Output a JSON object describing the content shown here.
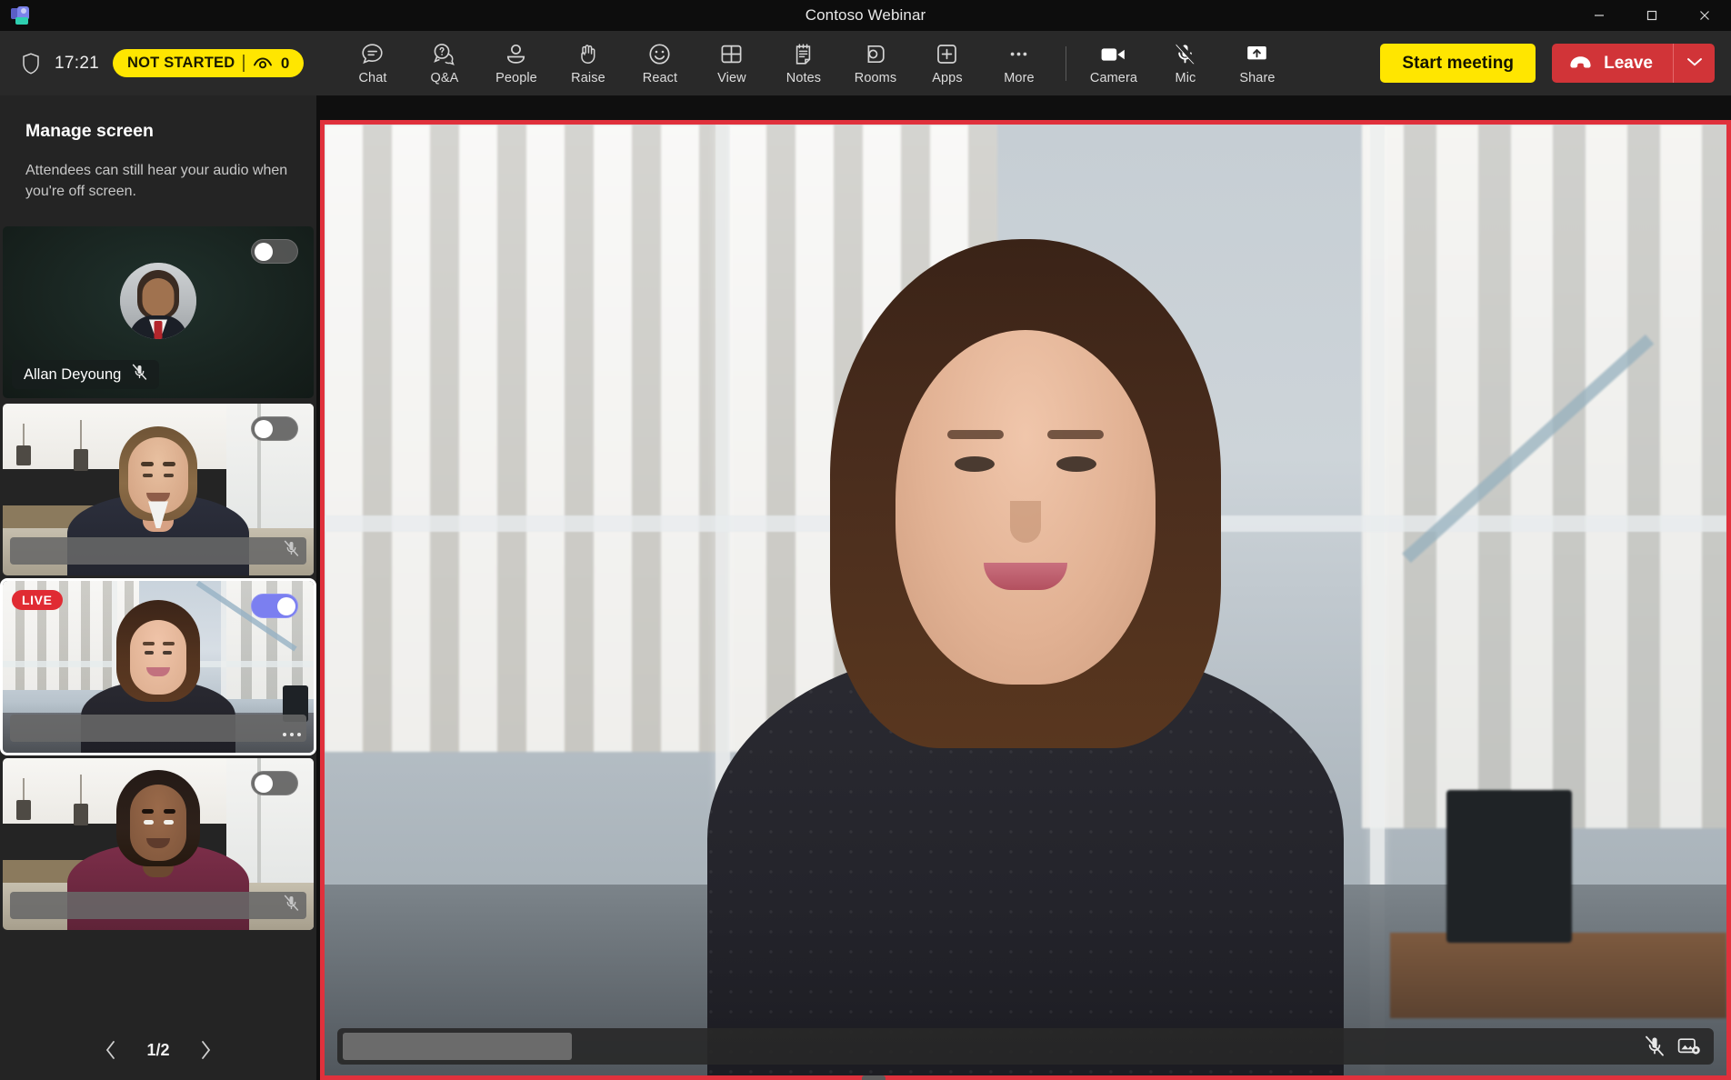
{
  "window": {
    "title": "Contoso Webinar",
    "app_icon": "teams-app-icon",
    "controls": {
      "minimize": "minimize-icon",
      "maximize": "maximize-icon",
      "close": "close-icon"
    }
  },
  "toolbar": {
    "shield_icon": "shield-icon",
    "time": "17:21",
    "status": {
      "label": "NOT STARTED",
      "viewers_icon": "eye-icon",
      "viewer_count": "0",
      "bg_color": "#ffe600"
    },
    "items": [
      {
        "label": "Chat",
        "icon": "chat-icon"
      },
      {
        "label": "Q&A",
        "icon": "question-bubble-icon"
      },
      {
        "label": "People",
        "icon": "person-icon"
      },
      {
        "label": "Raise",
        "icon": "raise-hand-icon"
      },
      {
        "label": "React",
        "icon": "smiley-icon"
      },
      {
        "label": "View",
        "icon": "grid-view-icon"
      },
      {
        "label": "Notes",
        "icon": "notes-icon"
      },
      {
        "label": "Rooms",
        "icon": "breakout-rooms-icon"
      },
      {
        "label": "Apps",
        "icon": "plus-box-icon"
      },
      {
        "label": "More",
        "icon": "ellipsis-icon"
      }
    ],
    "media": [
      {
        "label": "Camera",
        "icon": "camera-on-icon",
        "state": "on"
      },
      {
        "label": "Mic",
        "icon": "mic-muted-icon",
        "state": "muted"
      },
      {
        "label": "Share",
        "icon": "share-screen-icon",
        "state": "off"
      }
    ],
    "start_meeting_label": "Start meeting",
    "leave_label": "Leave",
    "leave_icon": "hangup-icon",
    "leave_caret_icon": "chevron-down-icon",
    "leave_color": "#d13438"
  },
  "panel": {
    "title": "Manage screen",
    "subtitle": "Attendees can still hear your audio when you're off screen.",
    "tiles": [
      {
        "name": "Allan Deyoung",
        "kind": "avatar",
        "toggle_on": false,
        "live": false,
        "muted": true,
        "name_redacted": false
      },
      {
        "name": "",
        "kind": "video-office",
        "toggle_on": false,
        "live": false,
        "muted": true,
        "name_redacted": true
      },
      {
        "name": "",
        "kind": "video-window",
        "toggle_on": true,
        "live": true,
        "live_label": "LIVE",
        "muted": false,
        "name_redacted": true,
        "selected": true
      },
      {
        "name": "",
        "kind": "video-office",
        "toggle_on": false,
        "live": false,
        "muted": true,
        "name_redacted": true
      }
    ],
    "pager": {
      "prev_icon": "chevron-left-icon",
      "label": "1/2",
      "next_icon": "chevron-right-icon"
    }
  },
  "stage": {
    "border_color": "#e0313c",
    "name_redacted": true,
    "mic_icon": "mic-muted-icon",
    "video_settings_icon": "video-background-icon"
  },
  "colors": {
    "accent_yellow": "#ffe600",
    "leave_red": "#d13438",
    "live_red": "#e02b33",
    "toggle_on_purple": "#7b7ff0",
    "stage_border_red": "#e0313c",
    "toolbar_bg": "#292929",
    "panel_bg": "#242424",
    "titlebar_bg": "#0d0d0d"
  }
}
